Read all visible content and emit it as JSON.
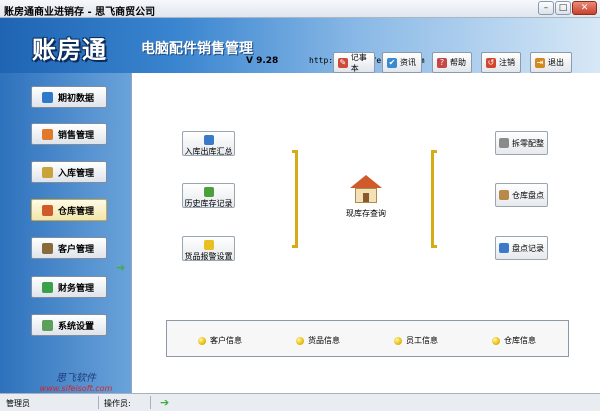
{
  "window": {
    "title": "账房通商业进销存 - 思飞商贸公司",
    "min_glyph": "–",
    "max_glyph": "□",
    "close_glyph": "✕"
  },
  "header": {
    "logo": "账房通",
    "app_title": "电脑配件销售管理",
    "version": "V 9.28",
    "url": "http://www.sifeisoft.com",
    "toolbar": [
      {
        "label": "记事本",
        "icon": "notepad-icon"
      },
      {
        "label": "资讯",
        "icon": "news-icon"
      },
      {
        "label": "帮助",
        "icon": "help-icon"
      },
      {
        "label": "注销",
        "icon": "logout-icon"
      },
      {
        "label": "退出",
        "icon": "exit-icon"
      }
    ]
  },
  "sidebar": {
    "items": [
      {
        "label": "期初数据",
        "icon": "book-icon"
      },
      {
        "label": "销售管理",
        "icon": "sales-icon"
      },
      {
        "label": "入库管理",
        "icon": "box-icon"
      },
      {
        "label": "仓库管理",
        "icon": "warehouse-icon"
      },
      {
        "label": "客户管理",
        "icon": "customers-icon"
      },
      {
        "label": "财务管理",
        "icon": "finance-icon"
      },
      {
        "label": "系统设置",
        "icon": "settings-icon"
      }
    ],
    "active_index": 3,
    "brand_cn": "思飞软件",
    "brand_web": "www.sifeisoft.com",
    "arrow_glyph": "➔"
  },
  "main": {
    "left_buttons": [
      {
        "label": "入库出库汇总",
        "icon": "people-icon"
      },
      {
        "label": "历史库存记录",
        "icon": "history-icon"
      },
      {
        "label": "货品报警设置",
        "icon": "warning-icon"
      }
    ],
    "center": {
      "label": "现库存查询",
      "icon": "house-icon"
    },
    "right_buttons": [
      {
        "label": "拆零配整",
        "icon": "tools-icon"
      },
      {
        "label": "仓库盘点",
        "icon": "inventory-icon"
      },
      {
        "label": "盘点记录",
        "icon": "records-icon"
      }
    ],
    "info_items": [
      "客户信息",
      "货品信息",
      "员工信息",
      "仓库信息"
    ]
  },
  "status": {
    "user": "管理员",
    "operator_label": "操作员:",
    "indicator": "➔"
  },
  "colors": {
    "header_blue": "#1e64b3",
    "bracket_gold": "#d7aa18",
    "close_red": "#c9402b"
  }
}
